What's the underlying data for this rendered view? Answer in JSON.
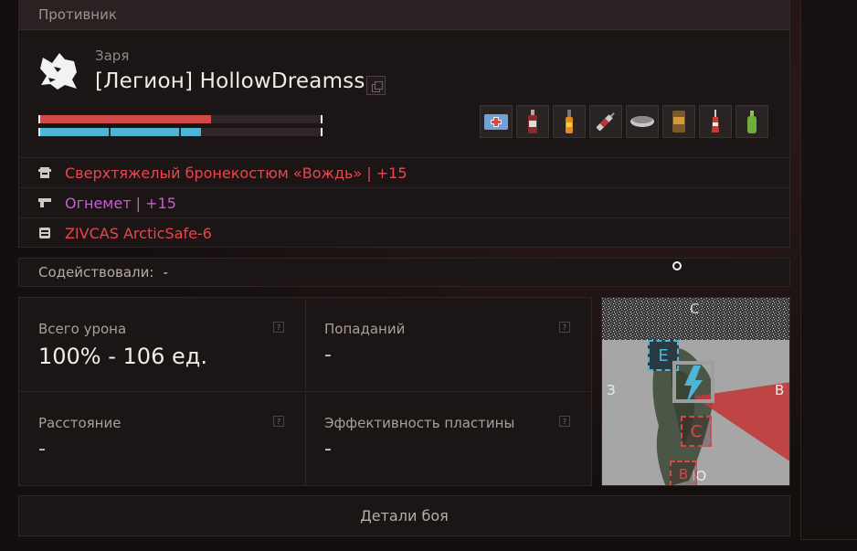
{
  "header": {
    "title": "Противник"
  },
  "player": {
    "rank": "Заря",
    "name": "[Легион] HollowDreamss"
  },
  "bars": {
    "health_fraction": 0.61,
    "armor_segments": [
      1.0,
      1.0,
      0.32
    ],
    "health_color": "#d14a4a",
    "armor_color": "#4fb5d5"
  },
  "consumables": [
    {
      "icon": "medkit-icon"
    },
    {
      "icon": "stim-bottle-icon"
    },
    {
      "icon": "flare-icon"
    },
    {
      "icon": "injector-icon"
    },
    {
      "icon": "pills-icon"
    },
    {
      "icon": "battery-can-icon"
    },
    {
      "icon": "red-bottle-icon"
    },
    {
      "icon": "green-bottle-icon"
    }
  ],
  "equipment": [
    {
      "icon": "armor-icon",
      "label": "Сверхтяжелый бронекостюм «Вождь» | +15",
      "color": "#e8474f"
    },
    {
      "icon": "weapon-icon",
      "label": "Огнемет | +15",
      "color": "#c55fd2"
    },
    {
      "icon": "container-icon",
      "label": "ZIVCAS ArcticSafe-6",
      "color": "#e8474f"
    }
  ],
  "coop": {
    "label": "Содействовали:",
    "value": "-"
  },
  "stats": {
    "total_damage": {
      "label": "Всего урона",
      "value": "100% - 106 ед.",
      "help": "?"
    },
    "hits": {
      "label": "Попаданий",
      "value": "-",
      "help": "?"
    },
    "distance": {
      "label": "Расстояние",
      "value": "-",
      "help": "?"
    },
    "plate_efficiency": {
      "label": "Эффективность пластины",
      "value": "-",
      "help": "?"
    }
  },
  "map": {
    "compass": {
      "north": "С",
      "south": "Ю",
      "west": "З",
      "east": "В"
    },
    "markers": {
      "e": "E",
      "c": "C",
      "b": "B"
    }
  },
  "details_button": {
    "label": "Детали боя"
  }
}
